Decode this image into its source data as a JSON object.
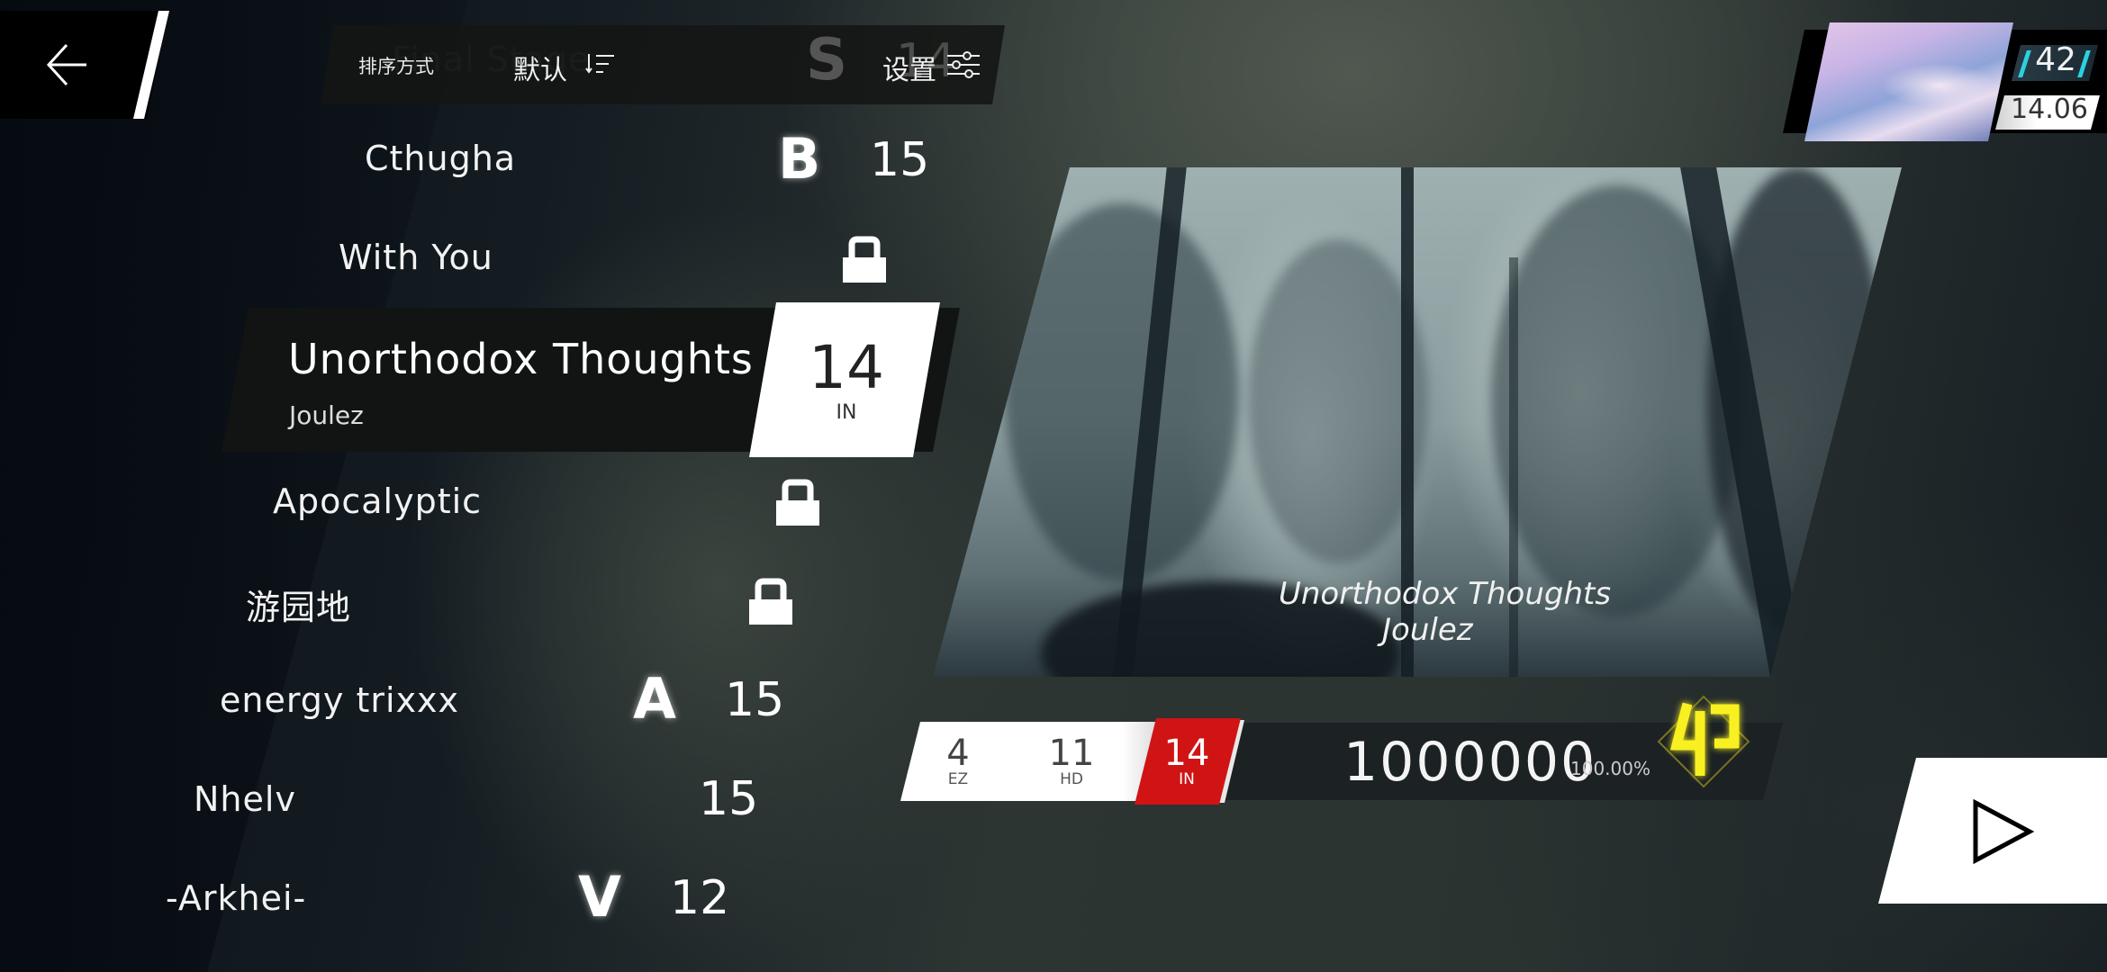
{
  "nav": {
    "back_icon": "arrow-left-icon"
  },
  "topbar": {
    "sort_label": "排序方式",
    "sort_value": "默认",
    "sort_icon": "sort-descending-icon",
    "settings_label": "设置",
    "settings_icon": "sliders-icon",
    "ghost_song": {
      "title": "Final Stage",
      "rank": "S",
      "level": "14"
    }
  },
  "songs": [
    {
      "title": "Cthugha",
      "rank": "B",
      "level": "15",
      "locked": false
    },
    {
      "title": "With You",
      "rank": "",
      "level": "",
      "locked": true
    },
    {
      "title": "Apocalyptic",
      "rank": "",
      "level": "",
      "locked": true
    },
    {
      "title": "游园地",
      "rank": "",
      "level": "",
      "locked": true
    },
    {
      "title": "energy trixxx",
      "rank": "A",
      "level": "15",
      "locked": false
    },
    {
      "title": "Nhelv",
      "rank": "",
      "level": "15",
      "locked": false
    },
    {
      "title": "-Arkhei-",
      "rank": "V",
      "level": "12",
      "locked": false
    }
  ],
  "selected": {
    "title": "Unorthodox Thoughts",
    "artist": "Joulez",
    "level": "14",
    "difficulty": "IN"
  },
  "illustration": {
    "title": "Unorthodox Thoughts",
    "artist": "Joulez"
  },
  "difficulties": [
    {
      "level": "4",
      "label": "EZ",
      "active": false
    },
    {
      "level": "11",
      "label": "HD",
      "active": false
    },
    {
      "level": "14",
      "label": "IN",
      "active": true
    }
  ],
  "record": {
    "score": "1000000",
    "accuracy": "100.00%",
    "badge_icon": "phi-full-combo-icon"
  },
  "player": {
    "level": "42",
    "rks": "14.06"
  },
  "colors": {
    "accent_red": "#d01414",
    "fc_yellow": "#f8f020",
    "level_cyan": "#2bd0e0"
  },
  "play": {
    "icon": "play-icon"
  }
}
